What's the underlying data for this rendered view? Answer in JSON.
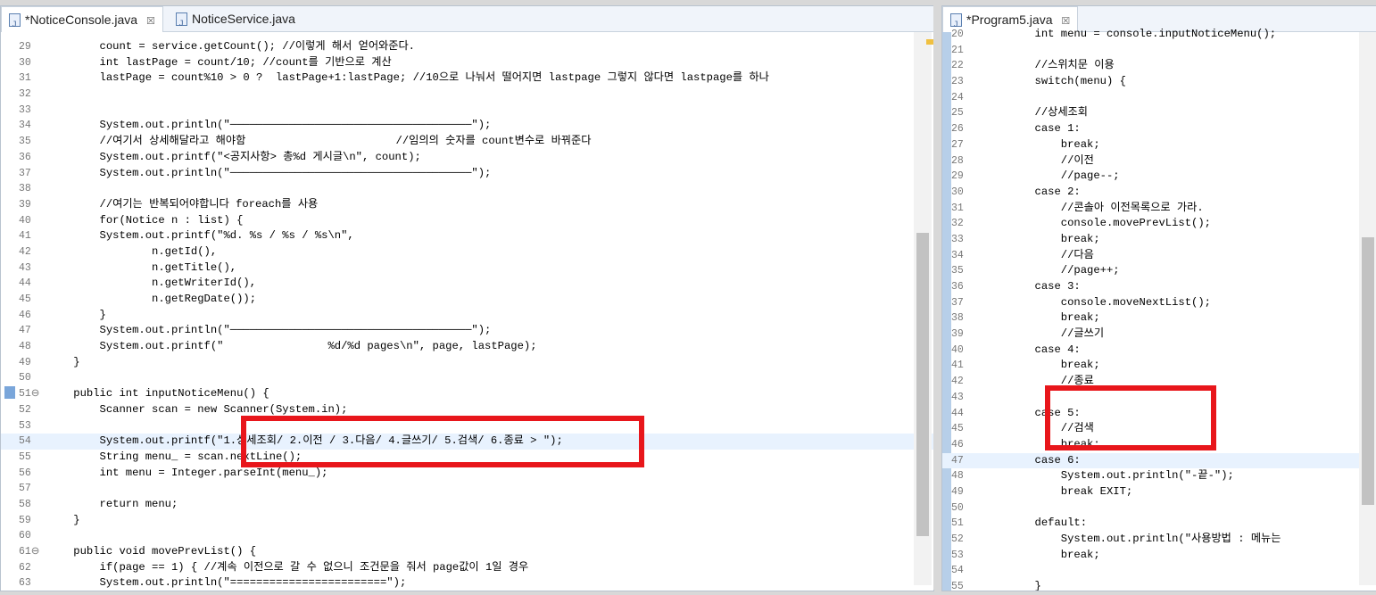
{
  "left_pane": {
    "tabs": [
      {
        "label": "*NoticeConsole.java",
        "close": "☒"
      },
      {
        "label": "NoticeService.java",
        "close": ""
      }
    ],
    "lines": [
      {
        "no": "29",
        "text": "        count = service.getCount(); //이렇게 해서 얻어와준다."
      },
      {
        "no": "30",
        "text": "        int lastPage = count/10; //count를 기반으로 계산"
      },
      {
        "no": "31",
        "text": "        lastPage = count%10 > 0 ?  lastPage+1:lastPage; //10으로 나눠서 떨어지면 lastpage 그렇지 않다면 lastpage를 하나"
      },
      {
        "no": "32",
        "text": ""
      },
      {
        "no": "33",
        "text": ""
      },
      {
        "no": "34",
        "text": "        System.out.println(\"─────────────────────────────────────\");"
      },
      {
        "no": "35",
        "text": "        //여기서 상세해달라고 해야함                       //임의의 숫자를 count변수로 바꿔준다"
      },
      {
        "no": "36",
        "text": "        System.out.printf(\"<공지사항> 총%d 게시글\\n\", count);"
      },
      {
        "no": "37",
        "text": "        System.out.println(\"─────────────────────────────────────\");"
      },
      {
        "no": "38",
        "text": ""
      },
      {
        "no": "39",
        "text": "        //여기는 반복되어야합니다 foreach를 사용"
      },
      {
        "no": "40",
        "text": "        for(Notice n : list) {"
      },
      {
        "no": "41",
        "text": "        System.out.printf(\"%d. %s / %s / %s\\n\","
      },
      {
        "no": "42",
        "text": "                n.getId(),"
      },
      {
        "no": "43",
        "text": "                n.getTitle(),"
      },
      {
        "no": "44",
        "text": "                n.getWriterId(),"
      },
      {
        "no": "45",
        "text": "                n.getRegDate());"
      },
      {
        "no": "46",
        "text": "        }"
      },
      {
        "no": "47",
        "text": "        System.out.println(\"─────────────────────────────────────\");"
      },
      {
        "no": "48",
        "text": "        System.out.printf(\"                %d/%d pages\\n\", page, lastPage);"
      },
      {
        "no": "49",
        "text": "    }"
      },
      {
        "no": "50",
        "text": ""
      },
      {
        "no": "51⊖",
        "text": "    public int inputNoticeMenu() {"
      },
      {
        "no": "52",
        "text": "        Scanner scan = new Scanner(System.in);"
      },
      {
        "no": "53",
        "text": ""
      },
      {
        "no": "54",
        "text": "        System.out.printf(\"1.상세조회/ 2.이전 / 3.다음/ 4.글쓰기/ 5.검색/ 6.종료 > \");"
      },
      {
        "no": "55",
        "text": "        String menu_ = scan.nextLine();"
      },
      {
        "no": "56",
        "text": "        int menu = Integer.parseInt(menu_);"
      },
      {
        "no": "57",
        "text": ""
      },
      {
        "no": "58",
        "text": "        return menu;"
      },
      {
        "no": "59",
        "text": "    }"
      },
      {
        "no": "60",
        "text": ""
      },
      {
        "no": "61⊖",
        "text": "    public void movePrevList() {"
      },
      {
        "no": "62",
        "text": "        if(page == 1) { //계속 이전으로 갈 수 없으니 조건문을 줘서 page값이 1일 경우"
      },
      {
        "no": "63",
        "text": "        System.out.println(\"========================\");"
      }
    ]
  },
  "right_pane": {
    "tabs": [
      {
        "label": "*Program5.java",
        "close": "☒"
      }
    ],
    "lines": [
      {
        "no": "20",
        "text": "        int menu = console.inputNoticeMenu();"
      },
      {
        "no": "21",
        "text": ""
      },
      {
        "no": "22",
        "text": "        //스위치문 이용"
      },
      {
        "no": "23",
        "text": "        switch(menu) {"
      },
      {
        "no": "24",
        "text": ""
      },
      {
        "no": "25",
        "text": "        //상세조회"
      },
      {
        "no": "26",
        "text": "        case 1:"
      },
      {
        "no": "27",
        "text": "            break;"
      },
      {
        "no": "28",
        "text": "            //이전"
      },
      {
        "no": "29",
        "text": "            //page--;"
      },
      {
        "no": "30",
        "text": "        case 2:"
      },
      {
        "no": "31",
        "text": "            //콘솔아 이전목록으로 가라."
      },
      {
        "no": "32",
        "text": "            console.movePrevList();"
      },
      {
        "no": "33",
        "text": "            break;"
      },
      {
        "no": "34",
        "text": "            //다음"
      },
      {
        "no": "35",
        "text": "            //page++;"
      },
      {
        "no": "36",
        "text": "        case 3:"
      },
      {
        "no": "37",
        "text": "            console.moveNextList();"
      },
      {
        "no": "38",
        "text": "            break;"
      },
      {
        "no": "39",
        "text": "            //글쓰기"
      },
      {
        "no": "40",
        "text": "        case 4:"
      },
      {
        "no": "41",
        "text": "            break;"
      },
      {
        "no": "42",
        "text": "            //종료"
      },
      {
        "no": "43",
        "text": ""
      },
      {
        "no": "44",
        "text": "        case 5:"
      },
      {
        "no": "45",
        "text": "            //검색"
      },
      {
        "no": "46",
        "text": "            break;"
      },
      {
        "no": "47",
        "text": "        case 6:"
      },
      {
        "no": "48",
        "text": "            System.out.println(\"-끝-\");"
      },
      {
        "no": "49",
        "text": "            break EXIT;"
      },
      {
        "no": "50",
        "text": ""
      },
      {
        "no": "51",
        "text": "        default:"
      },
      {
        "no": "52",
        "text": "            System.out.println(\"사용방법 : 메뉴는"
      },
      {
        "no": "53",
        "text": "            break;"
      },
      {
        "no": "54",
        "text": ""
      },
      {
        "no": "55",
        "text": "        }"
      }
    ]
  },
  "highlighted_line": {
    "left": "54",
    "right": "47"
  },
  "colors": {
    "annotation_box": "#e8161b",
    "current_line": "#e8f2fe"
  }
}
